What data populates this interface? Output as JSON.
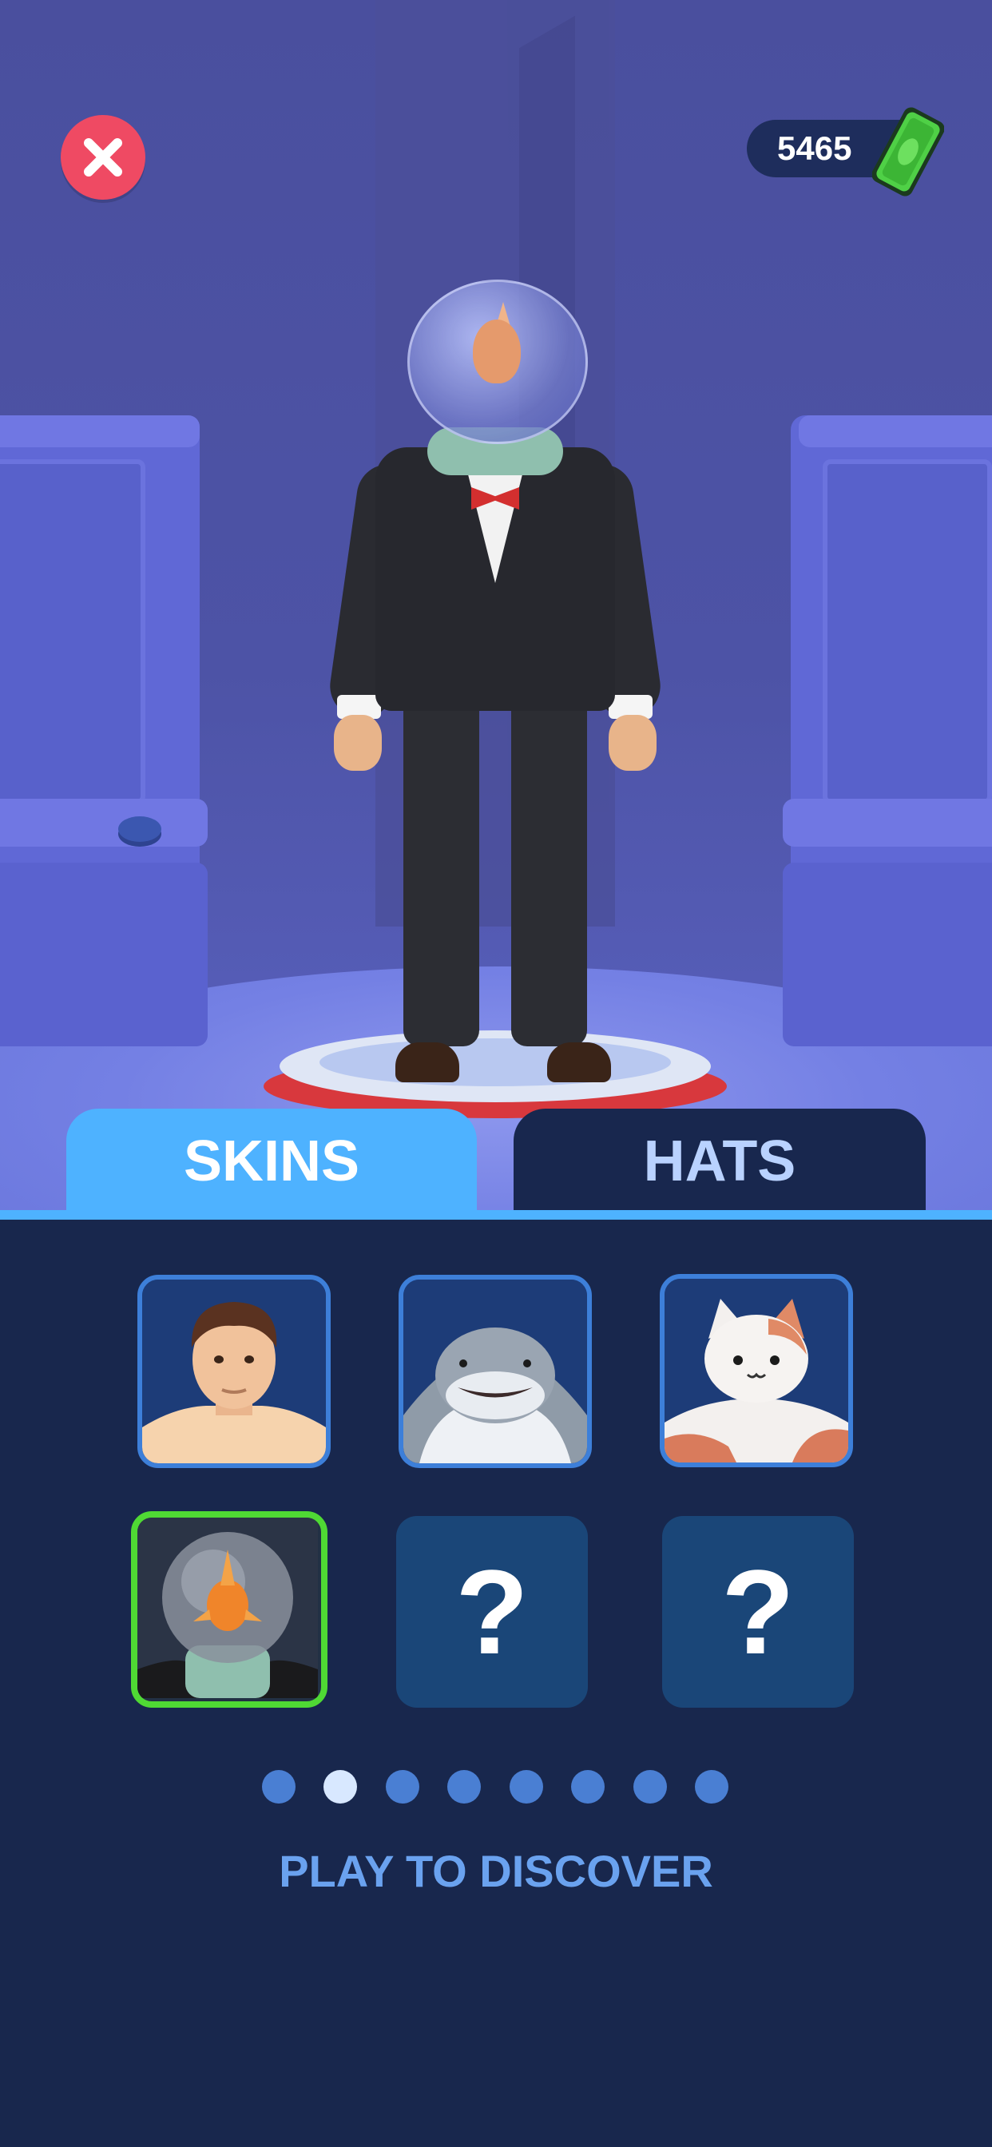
{
  "hud": {
    "currency_amount": "5465",
    "close_icon": "close-icon",
    "cash_icon": "cash-icon"
  },
  "tabs": [
    {
      "label": "SKINS",
      "active": true
    },
    {
      "label": "HATS",
      "active": false
    }
  ],
  "skins": [
    {
      "name": "man-skin",
      "state": "owned"
    },
    {
      "name": "shark-skin",
      "state": "owned"
    },
    {
      "name": "cat-skin",
      "state": "owned"
    },
    {
      "name": "fishbowl-skin",
      "state": "selected"
    },
    {
      "name": "locked-skin",
      "state": "locked",
      "label": "?"
    },
    {
      "name": "locked-skin",
      "state": "locked",
      "label": "?"
    }
  ],
  "pagination": {
    "total": 8,
    "current": 2
  },
  "footer": {
    "message": "PLAY TO DISCOVER"
  },
  "colors": {
    "accent": "#4eb2ff",
    "selected_border": "#4fd934",
    "close_button": "#ef4a63",
    "panel": "#18274d"
  }
}
